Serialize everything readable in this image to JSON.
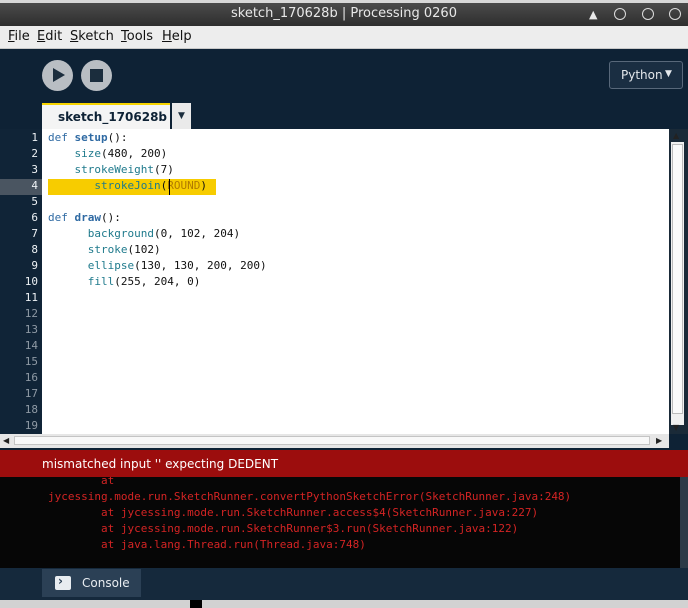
{
  "window": {
    "title": "sketch_170628b | Processing 0260",
    "controls": [
      "up-arrow-icon",
      "minimize-icon",
      "maximize-icon",
      "close-icon"
    ]
  },
  "menu": {
    "items": [
      {
        "label": "File",
        "mnemonic": "F",
        "rest": "ile"
      },
      {
        "label": "Edit",
        "mnemonic": "E",
        "rest": "dit"
      },
      {
        "label": "Sketch",
        "mnemonic": "S",
        "rest": "ketch"
      },
      {
        "label": "Tools",
        "mnemonic": "T",
        "rest": "ools"
      },
      {
        "label": "Help",
        "mnemonic": "H",
        "rest": "elp"
      }
    ]
  },
  "toolbar": {
    "run_icon": "play-icon",
    "stop_icon": "stop-icon",
    "mode": "Python",
    "mode_caret": "▼"
  },
  "tabs": {
    "active": "sketch_170628b",
    "menu_icon": "▼"
  },
  "editor": {
    "line_numbers": [
      "1",
      "2",
      "3",
      "4",
      "5",
      "6",
      "7",
      "8",
      "9",
      "10",
      "11",
      "12",
      "13",
      "14",
      "15",
      "16",
      "17",
      "18",
      "19"
    ],
    "highlighted_line": 4,
    "lines": [
      "def setup():",
      "    size(480, 200)",
      "    strokeWeight(7)",
      "       strokeJoin(ROUND)",
      "",
      "def draw():",
      "      background(0, 102, 204)",
      "      stroke(102)",
      "      ellipse(130, 130, 200, 200)",
      "      fill(255, 204, 0)"
    ]
  },
  "status": {
    "error_message": "mismatched input '' expecting DEDENT",
    "error_color": "#9c0d0d"
  },
  "console": {
    "lines": [
      "        at",
      "jycessing.mode.run.SketchRunner.convertPythonSketchError(SketchRunner.java:248)",
      "        at jycessing.mode.run.SketchRunner.access$4(SketchRunner.java:227)",
      "        at jycessing.mode.run.SketchRunner$3.run(SketchRunner.java:122)",
      "        at java.lang.Thread.run(Thread.java:748)"
    ],
    "tab_label": "Console",
    "tab_icon": "console-icon"
  },
  "colors": {
    "background": "#0e2235",
    "highlight": "#f7cc00",
    "console_text": "#d42424"
  }
}
